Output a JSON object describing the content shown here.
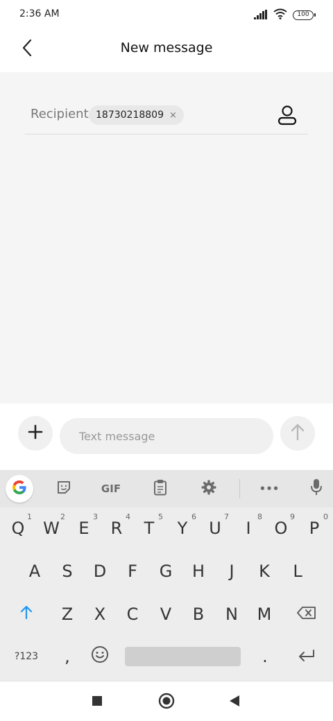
{
  "status_bar": {
    "time": "2:36 AM",
    "battery": "100",
    "icons": [
      "signal-icon",
      "wifi-icon",
      "battery-icon"
    ]
  },
  "header": {
    "title": "New message",
    "back_icon": "chevron-left-icon"
  },
  "recipient": {
    "label": "Recipient:",
    "chip_value": "18730218809",
    "chip_remove": "×",
    "contact_icon": "person-icon"
  },
  "compose": {
    "placeholder": "Text message",
    "add_icon": "plus-icon",
    "send_icon": "arrow-up-icon"
  },
  "keyboard": {
    "toolbar": {
      "gif_label": "GIF",
      "more_label": "•••",
      "icons": [
        "google-icon",
        "sticker-icon",
        "gif-icon",
        "clipboard-icon",
        "gear-icon",
        "more-icon",
        "mic-icon"
      ]
    },
    "row1": [
      {
        "key": "Q",
        "hint": "1"
      },
      {
        "key": "W",
        "hint": "2"
      },
      {
        "key": "E",
        "hint": "3"
      },
      {
        "key": "R",
        "hint": "4"
      },
      {
        "key": "T",
        "hint": "5"
      },
      {
        "key": "Y",
        "hint": "6"
      },
      {
        "key": "U",
        "hint": "7"
      },
      {
        "key": "I",
        "hint": "8"
      },
      {
        "key": "O",
        "hint": "9"
      },
      {
        "key": "P",
        "hint": "0"
      }
    ],
    "row2": [
      "A",
      "S",
      "D",
      "F",
      "G",
      "H",
      "J",
      "K",
      "L"
    ],
    "row3": [
      "Z",
      "X",
      "C",
      "V",
      "B",
      "N",
      "M"
    ],
    "row4": {
      "symbols": "?123",
      "comma": ",",
      "period": "."
    },
    "accent_color": "#2196f3"
  },
  "nav_bar": {
    "icons": [
      "square-icon",
      "circle-icon",
      "triangle-back-icon"
    ]
  }
}
